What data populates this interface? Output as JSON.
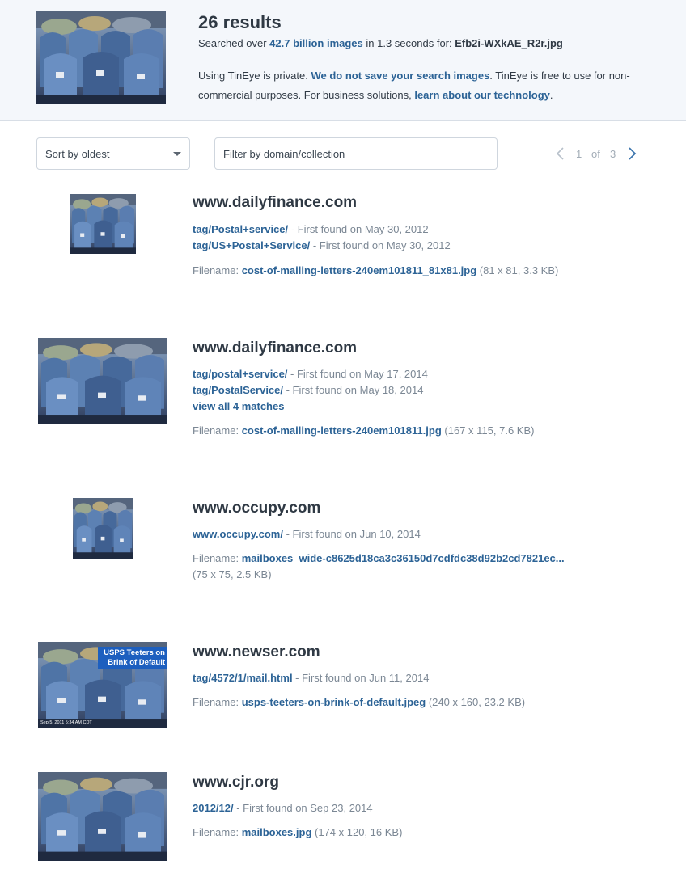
{
  "header": {
    "results_count": "26 results",
    "searched_prefix": "Searched over ",
    "searched_link": "42.7 billion images",
    "searched_mid": " in 1.3 seconds for: ",
    "searched_file": "Efb2i-WXkAE_R2r.jpg",
    "private_1": "Using TinEye is private. ",
    "private_link1": "We do not save your search images",
    "private_2": ". TinEye is free to use for non-commercial purposes. For business solutions, ",
    "private_link2": "learn about our technology",
    "private_3": "."
  },
  "controls": {
    "sort_value": "Sort by oldest",
    "filter_placeholder": "Filter by domain/collection",
    "page_current": "1",
    "page_of": "of",
    "page_total": "3"
  },
  "labels": {
    "first_found": " - First found on ",
    "filename": "Filename: "
  },
  "results": [
    {
      "domain": "www.dailyfinance.com",
      "matches": [
        {
          "path": "tag/Postal+service/",
          "date": "May 30, 2012"
        },
        {
          "path": "tag/US+Postal+Service/",
          "date": "May 30, 2012"
        }
      ],
      "filename": "cost-of-mailing-letters-240em101811_81x81.jpg",
      "fileinfo": " (81 x 81, 3.3 KB)"
    },
    {
      "domain": "www.dailyfinance.com",
      "matches": [
        {
          "path": "tag/postal+service/",
          "date": "May 17, 2014"
        },
        {
          "path": "tag/PostalService/",
          "date": "May 18, 2014"
        }
      ],
      "view_all": "view all 4 matches",
      "filename": "cost-of-mailing-letters-240em101811.jpg",
      "fileinfo": " (167 x 115, 7.6 KB)"
    },
    {
      "domain": "www.occupy.com",
      "matches": [
        {
          "path": "www.occupy.com/",
          "date": "Jun 10, 2014"
        }
      ],
      "filename": "mailboxes_wide-c8625d18ca3c36150d7cdfdc38d92b2cd7821ec...",
      "fileinfo": "(75 x 75, 2.5 KB)"
    },
    {
      "domain": "www.newser.com",
      "matches": [
        {
          "path": "tag/4572/1/mail.html",
          "date": "Jun 11, 2014"
        }
      ],
      "filename": "usps-teeters-on-brink-of-default.jpeg",
      "fileinfo": " (240 x 160, 23.2 KB)",
      "overlay_1": "USPS Teeters on",
      "overlay_2": "Brink of Default",
      "overlay_stamp": "Sep 5, 2011 5:34 AM CDT"
    },
    {
      "domain": "www.cjr.org",
      "matches": [
        {
          "path": "2012/12/",
          "date": "Sep 23, 2014"
        }
      ],
      "filename": "mailboxes.jpg",
      "fileinfo": " (174 x 120, 16 KB)"
    }
  ],
  "colors": {
    "link": "#2c6396",
    "header_bg": "#f4f7fb",
    "mailbox_blue": "#4f74a6"
  }
}
